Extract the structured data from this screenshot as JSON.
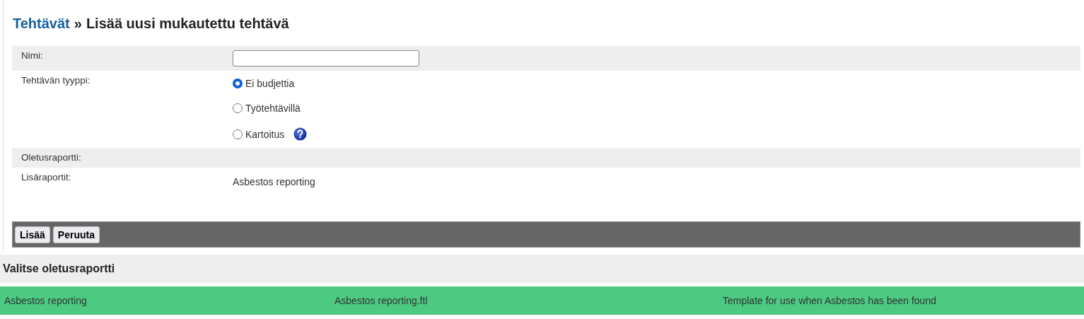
{
  "breadcrumb": {
    "link": "Tehtävät",
    "separator": "»",
    "title": "Lisää uusi mukautettu tehtävä"
  },
  "form": [
    {
      "kind": "text",
      "label": "Nimi:"
    },
    {
      "kind": "radio",
      "label": "Tehtävän tyyppi:",
      "options": [
        {
          "label": "Ei budjettia",
          "selected": true,
          "help": false
        },
        {
          "label": "Työtehtävillä",
          "selected": false,
          "help": false
        },
        {
          "label": "Kartoitus",
          "selected": false,
          "help": true
        }
      ]
    },
    {
      "kind": "static",
      "label": "Oletusraportti:"
    },
    {
      "kind": "static",
      "label": "Lisäraportit:",
      "value": "Asbestos reporting"
    }
  ],
  "buttons": [
    "Lisää",
    "Peruuta"
  ],
  "report_section": {
    "title": "Valitse oletusraportti",
    "rows": [
      {
        "name": "Asbestos reporting",
        "file": "Asbestos reporting.ftl",
        "description": "Template for use when Asbestos has been found"
      }
    ]
  }
}
